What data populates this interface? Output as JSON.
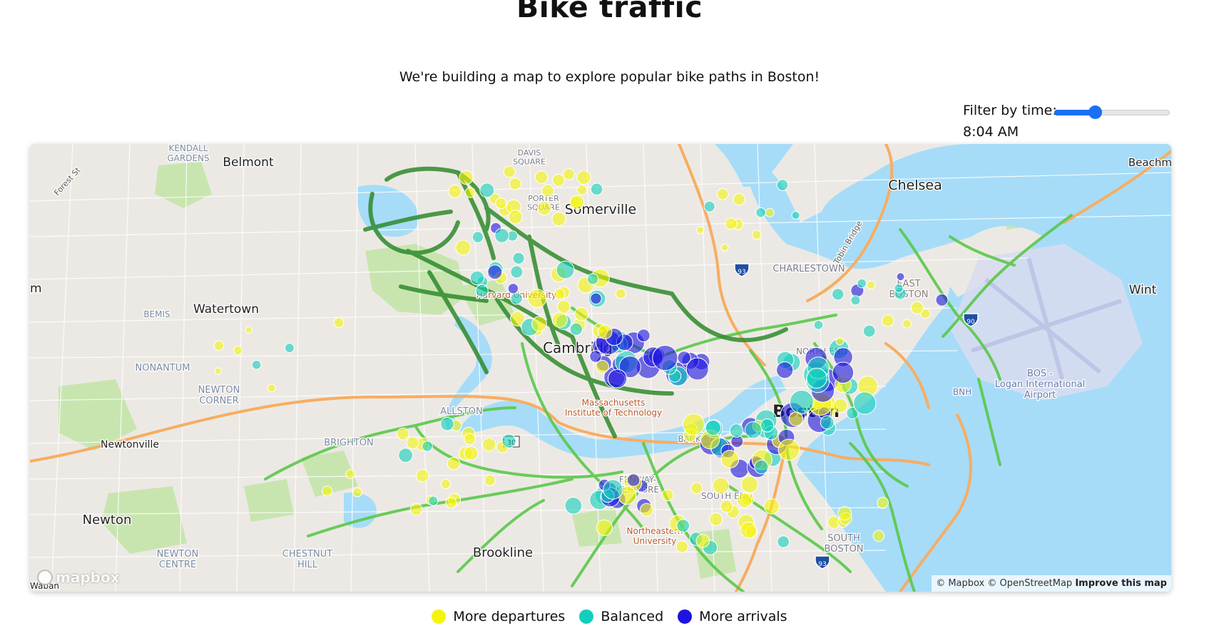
{
  "page": {
    "title": "Bike traffic",
    "subtitle": "We're building a map to explore popular bike paths in Boston!"
  },
  "filter": {
    "label": "Filter by time:",
    "value_fraction": 0.35,
    "time_display": "8:04 AM"
  },
  "map": {
    "provider_logo": "mapbox",
    "attribution": "© Mapbox © OpenStreetMap",
    "improve_link": "Improve this map",
    "places": {
      "belmont": "Belmont",
      "somerville": "Somerville",
      "chelsea": "Chelsea",
      "beachmont": "Beachmo",
      "watertown": "Watertown",
      "cambridge": "Cambridge",
      "boston": "Boston",
      "east_boston": "EAST\nBOSTON",
      "charlestown": "CHARLESTOWN",
      "kendall": "KENDALL\nGARDENS",
      "bemis": "BEMIS",
      "nonantum": "NONANTUM",
      "newton_corner": "NEWTON\nCORNER",
      "newtonville": "Newtonville",
      "newton": "Newton",
      "newton_centre": "NEWTON\nCENTRE",
      "chestnut_hill": "CHESTNUT\nHILL",
      "brookline": "Brookline",
      "allston": "ALLSTON",
      "brighton": "BRIGHTON",
      "mit": "Massachusetts\nInstitute of Technology",
      "harvard": "Harvard University",
      "northeastern": "Northeastern\nUniversity",
      "south_boston": "SOUTH\nBOSTON",
      "logan": "BOS -\nLogan International\nAirport",
      "bnh": "BNH",
      "winthrop": "Wint",
      "forest_st": "Forest St",
      "tobin": "Tobin Bridge",
      "north_end": "NORTH END",
      "south_end": "SOUTH END",
      "fenway": "FENWAY-\nKENMORE",
      "back_bay": "BACK BAY",
      "porter": "PORTER\nSQUARE",
      "davis": "DAVIS\nSQUARE",
      "ban": "Waban",
      "edge_m": "m",
      "shield_93": "93",
      "shield_90": "90",
      "shield_30": "30"
    }
  },
  "legend": [
    {
      "label": "More departures",
      "color": "#f5f50a"
    },
    {
      "label": "Balanced",
      "color": "#12cfbd"
    },
    {
      "label": "More arrivals",
      "color": "#1d14e0"
    }
  ],
  "colors": {
    "water": "#a6dcf8",
    "park": "#c8e5b0",
    "bike_lane": "#5bc84a",
    "bike_path_dark": "#2f8a2c",
    "highway": "#f7ad62",
    "departures": "#f5f50a",
    "balanced": "#12cfbd",
    "arrivals": "#1d14e0"
  }
}
